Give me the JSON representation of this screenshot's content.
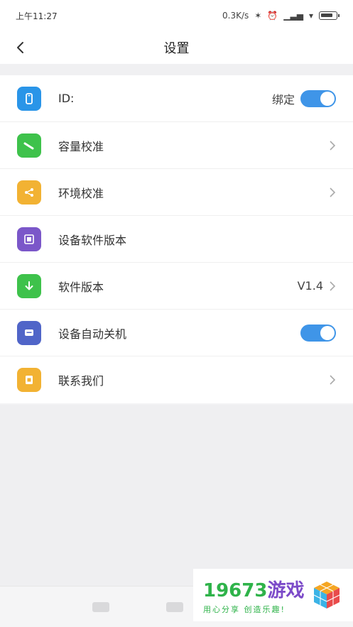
{
  "status_bar": {
    "time": "上午11:27",
    "net_speed": "0.3K/s"
  },
  "nav": {
    "title": "设置"
  },
  "settings": [
    {
      "key": "id",
      "label": "ID:",
      "icon": "phone-icon",
      "color": "#2a95e8",
      "value": "绑定",
      "control": "toggle",
      "on": true
    },
    {
      "key": "capacity",
      "label": "容量校准",
      "icon": "pencil-icon",
      "color": "#3ec24b",
      "control": "chevron"
    },
    {
      "key": "environment",
      "label": "环境校准",
      "icon": "share-icon",
      "color": "#f2b233",
      "control": "chevron"
    },
    {
      "key": "device_fw",
      "label": "设备软件版本",
      "icon": "chip-icon",
      "color": "#7b57c9",
      "control": "none"
    },
    {
      "key": "software",
      "label": "软件版本",
      "icon": "download-icon",
      "color": "#3ec24b",
      "value": "V1.4",
      "control": "chevron"
    },
    {
      "key": "auto_off",
      "label": "设备自动关机",
      "icon": "message-icon",
      "color": "#5065c8",
      "control": "toggle",
      "on": true
    },
    {
      "key": "contact",
      "label": "联系我们",
      "icon": "contact-icon",
      "color": "#f2b233",
      "control": "chevron"
    }
  ],
  "watermark": {
    "title_num": "19673",
    "title_word": "游戏",
    "subtitle": "用心分享 创造乐趣!"
  }
}
